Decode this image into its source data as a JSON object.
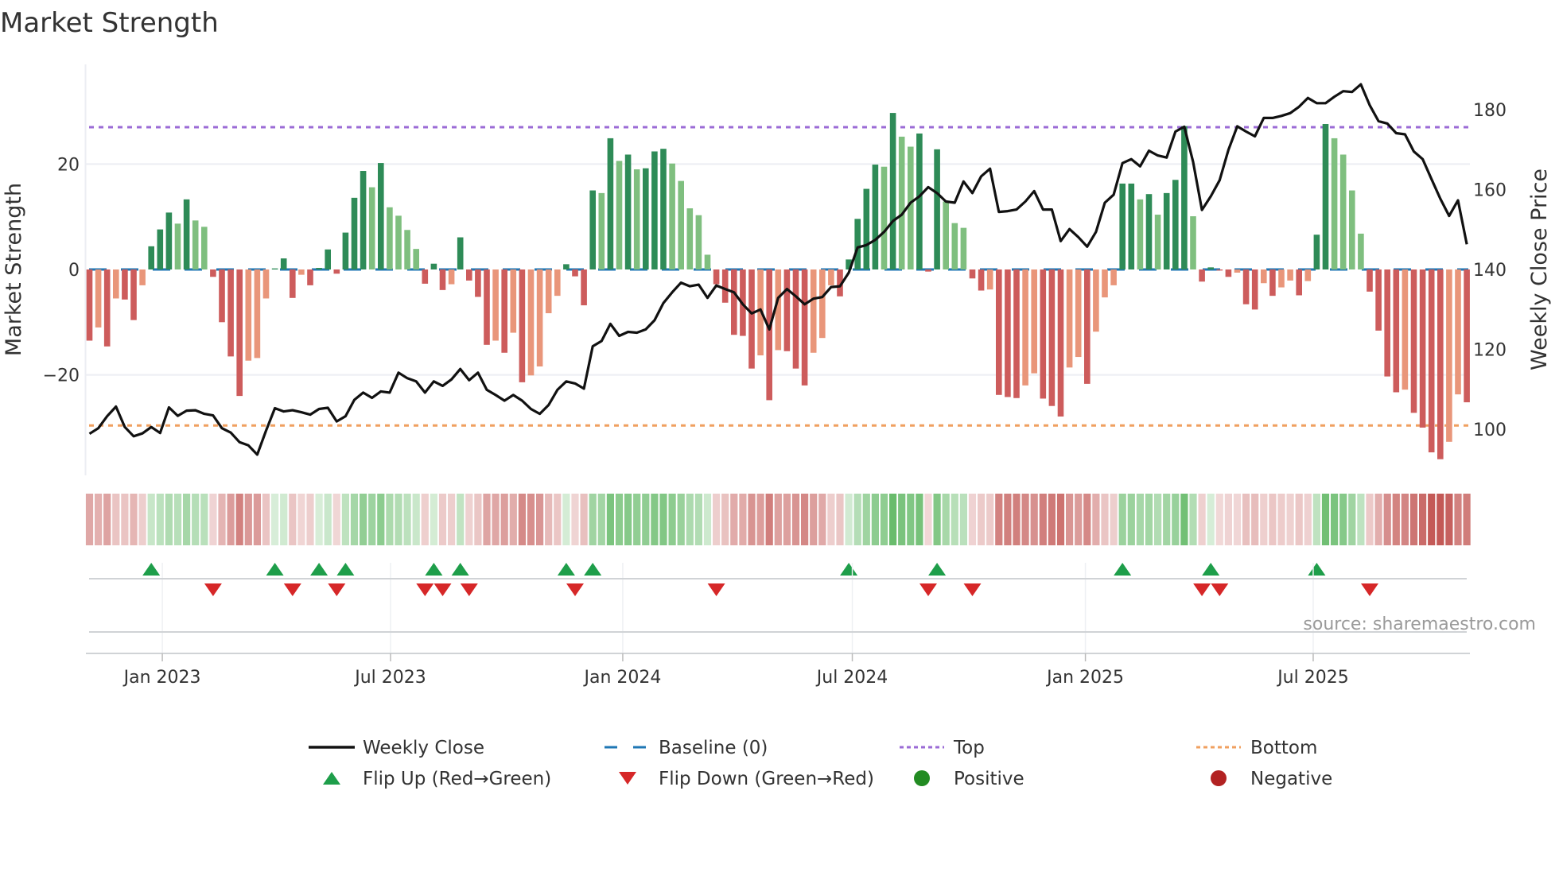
{
  "colors": {
    "bar_up_strong": "#2e8b57",
    "bar_up_weak": "#7fbf7f",
    "bar_down_strong": "#cd5c5c",
    "bar_down_weak": "#e9967a",
    "price_line": "#111111",
    "baseline": "#1f77b4",
    "top": "#9b6bd6",
    "bottom": "#f0a060",
    "flip_up": "#1e9e4a",
    "flip_down": "#d62728",
    "positive": "#228b22",
    "negative": "#b22222",
    "heat_pos": "#4caf50",
    "heat_neg": "#c0504d"
  },
  "chart_data": {
    "type": "bar",
    "title": "Market Strength",
    "ylabel": "Market Strength",
    "y2label": "Weekly Close Price",
    "ylim": [
      -39,
      39
    ],
    "y2lim": [
      88,
      192
    ],
    "yticks": [
      {
        "value": 20,
        "label": "20"
      },
      {
        "value": 0,
        "label": "0"
      },
      {
        "value": -20,
        "label": "−20"
      }
    ],
    "y2ticks": [
      {
        "value": 180,
        "label": "180"
      },
      {
        "value": 160,
        "label": "160"
      },
      {
        "value": 140,
        "label": "140"
      },
      {
        "value": 120,
        "label": "120"
      },
      {
        "value": 100,
        "label": "100"
      }
    ],
    "xticks": [
      {
        "week": 8.25,
        "label": "Jan 2023"
      },
      {
        "week": 34.1,
        "label": "Jul 2023"
      },
      {
        "week": 60.4,
        "label": "Jan 2024"
      },
      {
        "week": 86.4,
        "label": "Jul 2024"
      },
      {
        "week": 112.8,
        "label": "Jan 2025"
      },
      {
        "week": 138.6,
        "label": "Jul 2025"
      }
    ],
    "grid": true,
    "top_level": 27,
    "bottom_level": -29.6,
    "baseline": 0,
    "strength": [
      -13.5,
      -11,
      -14.6,
      -5.5,
      -5.7,
      -9.6,
      -3,
      4.4,
      7.6,
      10.8,
      8.7,
      13.3,
      9.3,
      8.1,
      -1.4,
      -10,
      -16.5,
      -24,
      -17.3,
      -16.8,
      -5.5,
      0.2,
      2.1,
      -5.4,
      -1,
      -3,
      0.3,
      3.8,
      -0.8,
      7,
      13.6,
      18.7,
      15.6,
      20.2,
      11.8,
      10.2,
      7.5,
      3.9,
      -2.7,
      1.1,
      -3.9,
      -2.8,
      6.1,
      -2.1,
      -5.2,
      -14.3,
      -13.5,
      -15.8,
      -12,
      -21.4,
      -20.1,
      -18.4,
      -8.3,
      -5,
      1,
      -1.3,
      -6.8,
      15,
      14.5,
      24.9,
      20.6,
      21.8,
      19,
      19.2,
      22.4,
      22.9,
      20.1,
      16.8,
      11.6,
      10.3,
      2.8,
      -2.8,
      -6.3,
      -12.4,
      -12.6,
      -18.8,
      -16.3,
      -24.8,
      -15.3,
      -15.5,
      -18.8,
      -22,
      -15.8,
      -13,
      -3,
      -5.1,
      1.9,
      9.6,
      15.3,
      19.9,
      19.5,
      29.7,
      25.2,
      23.3,
      25.8,
      -0.4,
      22.8,
      12.9,
      8.8,
      7.9,
      -1.7,
      -4,
      -3.8,
      -23.8,
      -24.2,
      -24.4,
      -22,
      -19.7,
      -24.5,
      -25.9,
      -27.9,
      -18.6,
      -16.6,
      -21.7,
      -11.8,
      -5.3,
      -3,
      16.3,
      16.3,
      13.3,
      14.3,
      10.4,
      14.5,
      17,
      27.2,
      10.1,
      -2.3,
      0.4,
      -0.2,
      -1.4,
      -0.6,
      -6.6,
      -7.6,
      -2.6,
      -5,
      -3.4,
      -2.1,
      -4.9,
      -2.2,
      6.6,
      27.6,
      24.9,
      21.8,
      15,
      6.8,
      -4.2,
      -11.6,
      -20.3,
      -23.3,
      -22.8,
      -27.2,
      -30,
      -34.7,
      -36,
      -32.7,
      -23.7,
      -25.2
    ],
    "weekly_close": [
      98.9,
      100.3,
      103.3,
      105.7,
      100.6,
      98.3,
      99,
      100.6,
      99.1,
      105.5,
      103.4,
      104.7,
      104.8,
      103.9,
      103.5,
      100.3,
      99.2,
      96.8,
      96,
      93.7,
      99.7,
      105.3,
      104.5,
      104.8,
      104.3,
      103.7,
      105.1,
      105.4,
      102,
      103.3,
      107.4,
      109.2,
      107.9,
      109.5,
      109.2,
      114.2,
      112.8,
      112,
      109.2,
      112,
      110.9,
      112.5,
      115.1,
      112.3,
      114.2,
      109.9,
      108.6,
      107.2,
      108.6,
      107.2,
      105.1,
      103.9,
      106.1,
      109.9,
      112,
      111.5,
      110.2,
      120.8,
      122.1,
      126.4,
      123.4,
      124.4,
      124.2,
      125,
      127.3,
      131.6,
      134.3,
      136.7,
      135.8,
      136.2,
      132.9,
      136,
      135.1,
      134.3,
      131.3,
      129,
      130,
      125,
      132.9,
      135.1,
      133.3,
      131.3,
      132.7,
      133.1,
      135.6,
      135.8,
      139.2,
      145.5,
      146.1,
      147.4,
      149.4,
      152.1,
      153.7,
      156.7,
      158.3,
      160.6,
      159.1,
      157,
      156.7,
      162,
      159.1,
      163.3,
      165.2,
      154.4,
      154.6,
      155,
      157,
      159.6,
      155,
      155,
      147.1,
      150.1,
      148.1,
      145.7,
      149.4,
      156.7,
      158.7,
      166.6,
      167.6,
      165.8,
      169.7,
      168.5,
      168,
      174.5,
      175.7,
      166.9,
      154.9,
      158.3,
      162.3,
      169.9,
      175.8,
      174.5,
      173.3,
      177.9,
      177.9,
      178.4,
      179.1,
      180.7,
      182.9,
      181.6,
      181.6,
      183.2,
      184.6,
      184.4,
      186.3,
      181.1,
      177.1,
      176.5,
      174.1,
      173.8,
      169.5,
      167.6,
      162.6,
      157.7,
      153.4,
      157.3,
      146.3
    ],
    "flip_up_weeks": [
      7,
      21,
      26,
      29,
      39,
      42,
      54,
      57,
      86,
      96,
      117,
      127,
      139
    ],
    "flip_down_weeks": [
      14,
      23,
      28,
      38,
      40,
      43,
      55,
      71,
      95,
      100,
      126,
      128,
      145
    ],
    "legend": {
      "placement": "bottom",
      "items": [
        {
          "key": "weekly_close",
          "label": "Weekly Close"
        },
        {
          "key": "baseline",
          "label": "Baseline (0)"
        },
        {
          "key": "top",
          "label": "Top"
        },
        {
          "key": "bottom",
          "label": "Bottom"
        },
        {
          "key": "flip_up",
          "label": "Flip Up (Red→Green)"
        },
        {
          "key": "flip_down",
          "label": "Flip Down (Green→Red)"
        },
        {
          "key": "positive",
          "label": "Positive"
        },
        {
          "key": "negative",
          "label": "Negative"
        }
      ]
    },
    "source": "source: sharemaestro.com"
  }
}
